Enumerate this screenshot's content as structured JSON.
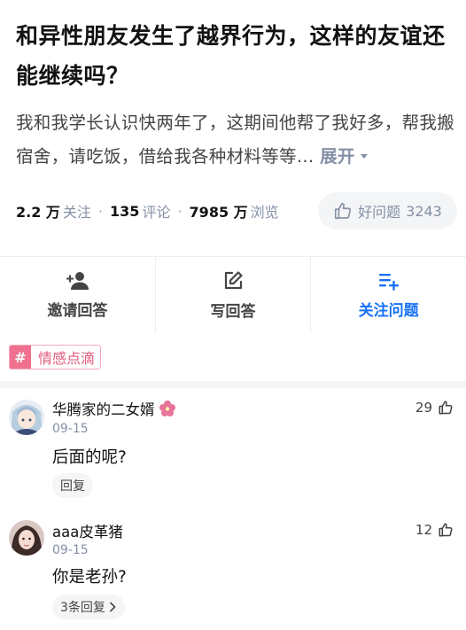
{
  "question": {
    "title": "和异性朋友发生了越界行为，这样的友谊还能继续吗？",
    "excerpt": "我和我学长认识快两年了，这期间他帮了我好多，帮我搬宿舍，请吃饭，借给我各种材料等等…",
    "expand_label": "展开"
  },
  "stats": {
    "followers_num": "2.2 万",
    "followers_label": "关注",
    "comments_num": "135",
    "comments_label": "评论",
    "views_num": "7985 万",
    "views_label": "浏览",
    "separator": "·"
  },
  "good_question": {
    "label": "好问题",
    "count": "3243"
  },
  "actions": [
    {
      "label": "邀请回答",
      "icon": "invite-user-icon"
    },
    {
      "label": "写回答",
      "icon": "edit-icon"
    },
    {
      "label": "关注问题",
      "icon": "follow-list-icon"
    }
  ],
  "topic": {
    "hash": "#",
    "label": "情感点滴"
  },
  "comments": [
    {
      "author": "华腾家的二女婿",
      "badge_icon": "sakura-flower-icon",
      "date": "09-15",
      "text": "后面的呢?",
      "likes": "29",
      "reply_label": "回复"
    },
    {
      "author": "aaa皮革猪",
      "date": "09-15",
      "text": "你是老孙?",
      "likes": "12",
      "reply_label": "3条回复"
    }
  ],
  "colors": {
    "accent": "#1772f6",
    "muted": "#8590a6",
    "topic_pink": "#f0708f"
  }
}
